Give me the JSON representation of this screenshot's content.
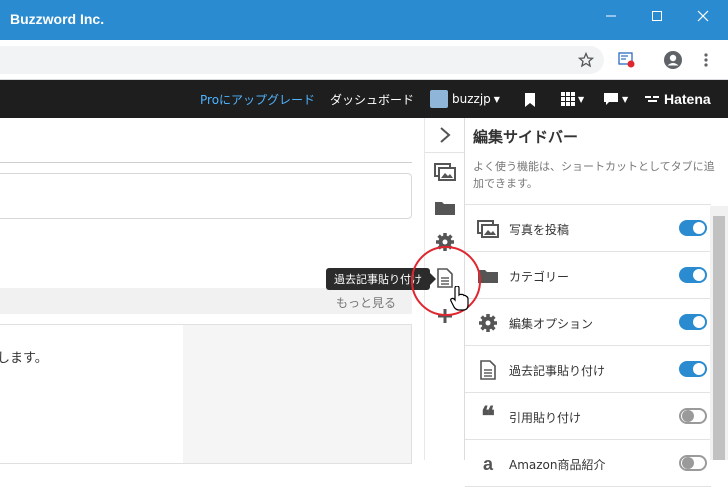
{
  "window": {
    "title": "Buzzword Inc.",
    "controls": [
      "minimize",
      "maximize",
      "close"
    ]
  },
  "browser": {
    "icons": [
      "star-icon",
      "extension-icon",
      "profile-icon",
      "menu-icon"
    ]
  },
  "hatena_header": {
    "upgrade_link": "Proにアップグレード",
    "dashboard_link": "ダッシュボード",
    "username": "buzzjp",
    "brand": "Hatena",
    "accent_color": "#4fb3ff"
  },
  "main": {
    "more_link": "もっと見る",
    "body_text": "します。"
  },
  "sidebar": {
    "title": "編集サイドバー",
    "description": "よく使う機能は、ショートカットとしてタブに追加できます。",
    "items": [
      {
        "label": "写真を投稿",
        "icon": "photo-icon",
        "enabled": true
      },
      {
        "label": "カテゴリー",
        "icon": "folder-icon",
        "enabled": true
      },
      {
        "label": "編集オプション",
        "icon": "gear-icon",
        "enabled": true
      },
      {
        "label": "過去記事貼り付け",
        "icon": "document-icon",
        "enabled": true
      },
      {
        "label": "引用貼り付け",
        "icon": "quote-icon",
        "enabled": false
      },
      {
        "label": "Amazon商品紹介",
        "icon": "amazon-icon",
        "enabled": false
      }
    ],
    "toggle_on_color": "#2a8bd0"
  },
  "tooltip": {
    "text": "過去記事貼り付け"
  }
}
